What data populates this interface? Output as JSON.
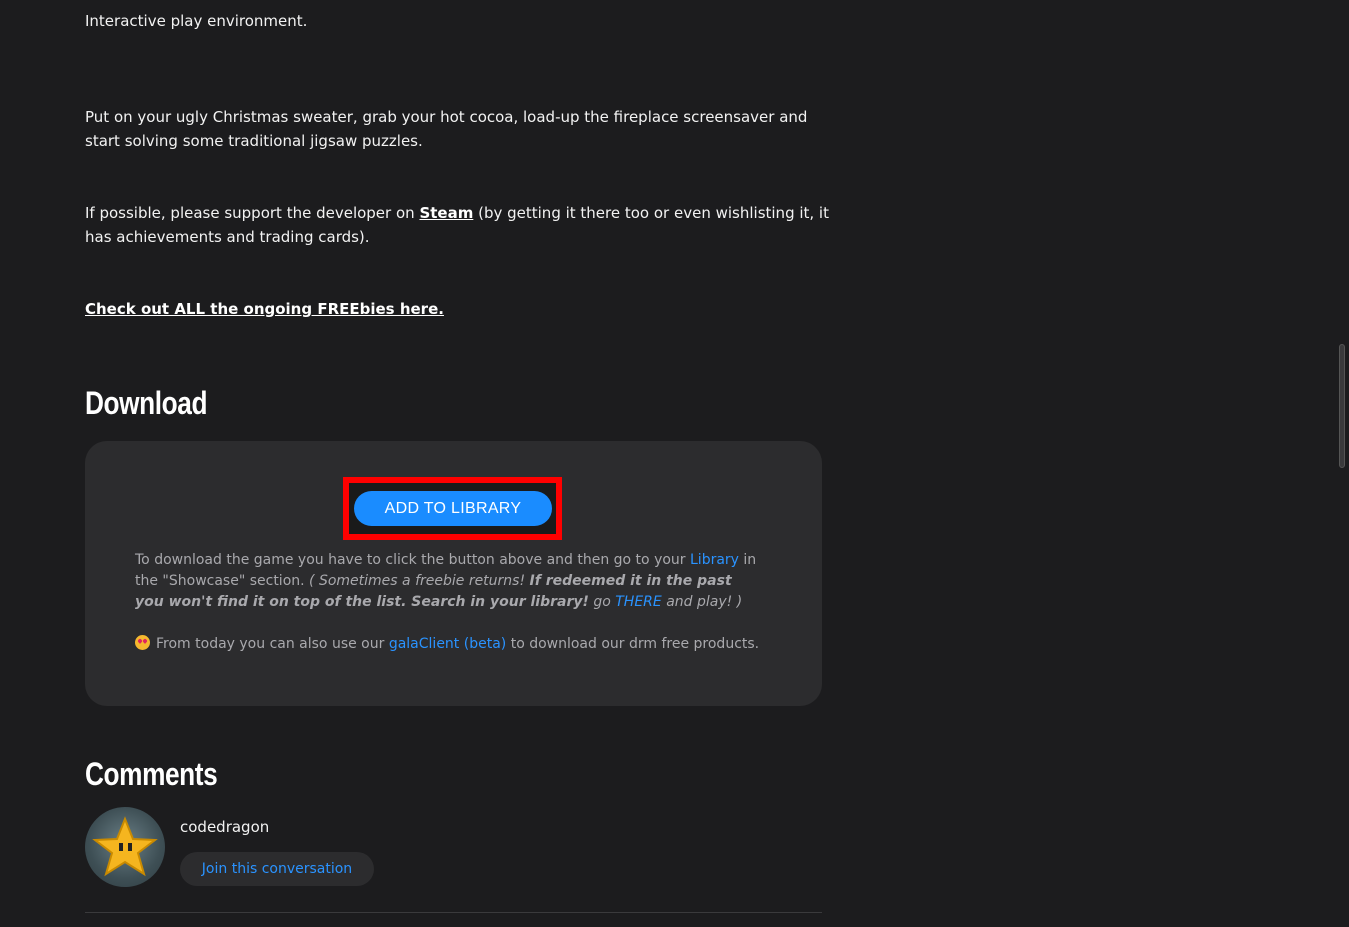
{
  "intro": {
    "line1": "Interactive play environment.",
    "para2": "Put on your ugly Christmas sweater, grab your hot cocoa, load-up the fireplace screensaver and start solving some traditional jigsaw puzzles.",
    "support_before": "If possible, please support the developer on ",
    "support_link": "Steam",
    "support_after": " (by getting it there too or even wishlisting it, it has achievements and trading cards).",
    "freebies_link": "Check out ALL the ongoing FREEbies here."
  },
  "download": {
    "heading": "Download",
    "button_label": "ADD TO LIBRARY",
    "text_before_library": "To download the game you have to click the button above and then go to your ",
    "library_link": "Library",
    "text_after_library": " in the \"Showcase\" section. ",
    "italic_open": "( Sometimes a freebie returns! ",
    "italic_bold": "If redeemed it in the past you won't find it on top of the list. Search in your library!",
    "italic_go": " go ",
    "there_link": "THERE",
    "italic_close": " and play! )",
    "gala_before": "From today you can also use our ",
    "gala_link": "galaClient (beta)",
    "gala_after": " to download our drm free products."
  },
  "comments": {
    "heading": "Comments",
    "username": "codedragon",
    "join_label": "Join this conversation"
  },
  "colors": {
    "background": "#1c1c1e",
    "card": "#2c2c2e",
    "accent": "#1a8cff",
    "link": "#2a93ff",
    "highlight": "#ff0000"
  },
  "icons": {
    "avatar": "star-avatar-icon",
    "emoji": "star-struck-emoji-icon"
  }
}
